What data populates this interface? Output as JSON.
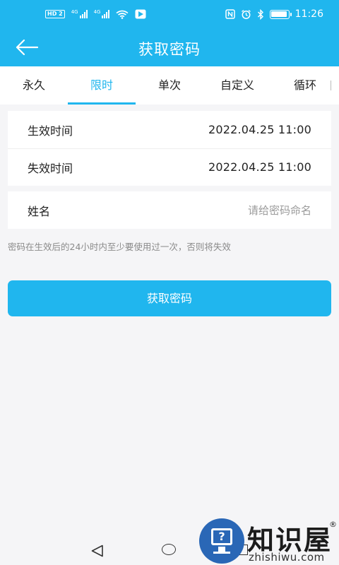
{
  "status_bar": {
    "hd_badge": "HD 2",
    "net_label_1": "4G",
    "net_label_2": "4G",
    "time": "11:26",
    "battery_percent": 95,
    "icons": [
      "hd-icon",
      "signal-icon",
      "signal-icon",
      "wifi-icon",
      "play-store-icon",
      "nfc-icon",
      "alarm-icon",
      "bluetooth-icon",
      "battery-icon"
    ]
  },
  "app_bar": {
    "title": "获取密码",
    "back_icon": "arrow-left-icon"
  },
  "tabs": [
    {
      "label": "永久",
      "active": false
    },
    {
      "label": "限时",
      "active": true
    },
    {
      "label": "单次",
      "active": false
    },
    {
      "label": "自定义",
      "active": false
    },
    {
      "label": "循环",
      "active": false
    }
  ],
  "time_card": {
    "start_label": "生效时间",
    "start_value": "2022.04.25 11:00",
    "end_label": "失效时间",
    "end_value": "2022.04.25 11:00"
  },
  "name_card": {
    "label": "姓名",
    "placeholder": "请给密码命名"
  },
  "hint": "密码在生效后的24小时内至少要使用过一次，否则将失效",
  "submit_button": "获取密码",
  "nav_bar": {
    "icons": [
      "nav-back-icon",
      "nav-home-icon",
      "nav-recent-icon"
    ]
  },
  "watermark": {
    "brand": "知识屋",
    "reg": "®",
    "site": "zhishiwu.com"
  },
  "colors": {
    "accent": "#20b6ee",
    "background": "#f5f5f7",
    "placeholder": "#9b9b9b"
  }
}
